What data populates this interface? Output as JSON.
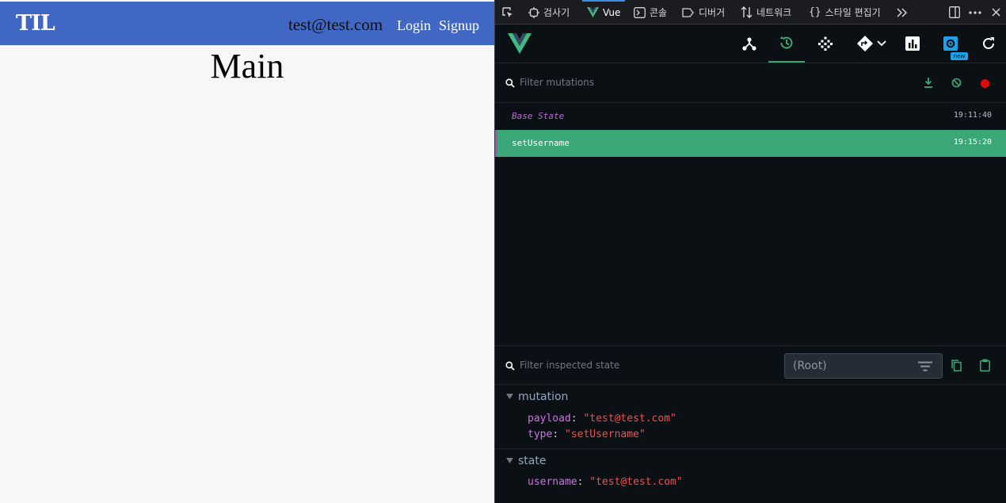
{
  "app": {
    "logo": "TIL",
    "username": "test@test.com",
    "nav_login": "Login",
    "nav_signup": "Signup",
    "page_title": "Main"
  },
  "devtools": {
    "tabs": [
      "검사기",
      "Vue",
      "콘솔",
      "디버거",
      "네트워크",
      "스타일 편집기"
    ],
    "active_tab": "Vue",
    "toolbar": {
      "active_tool": "timeline",
      "badge": "new",
      "tools": [
        "components-icon",
        "timeline-icon",
        "vuex-icon",
        "router-icon",
        "performance-icon",
        "settings-icon",
        "refresh-icon"
      ]
    },
    "mutations": {
      "filter_placeholder": "Filter mutations",
      "items": [
        {
          "name": "Base State",
          "time": "19:11:40"
        },
        {
          "name": "setUsername",
          "time": "19:15:20"
        }
      ],
      "selected": "setUsername"
    },
    "inspector": {
      "filter_placeholder": "Filter inspected state",
      "root_select": "(Root)",
      "mutation_section": "mutation",
      "payload_key": "payload",
      "payload_value": "\"test@test.com\"",
      "type_key": "type",
      "type_value": "\"setUsername\"",
      "state_section": "state",
      "username_key": "username",
      "username_value": "\"test@test.com\""
    },
    "colors": {
      "accent": "#3ba776",
      "app_header": "#4067c4",
      "key": "#d36ee8",
      "string": "#ee5050"
    }
  }
}
